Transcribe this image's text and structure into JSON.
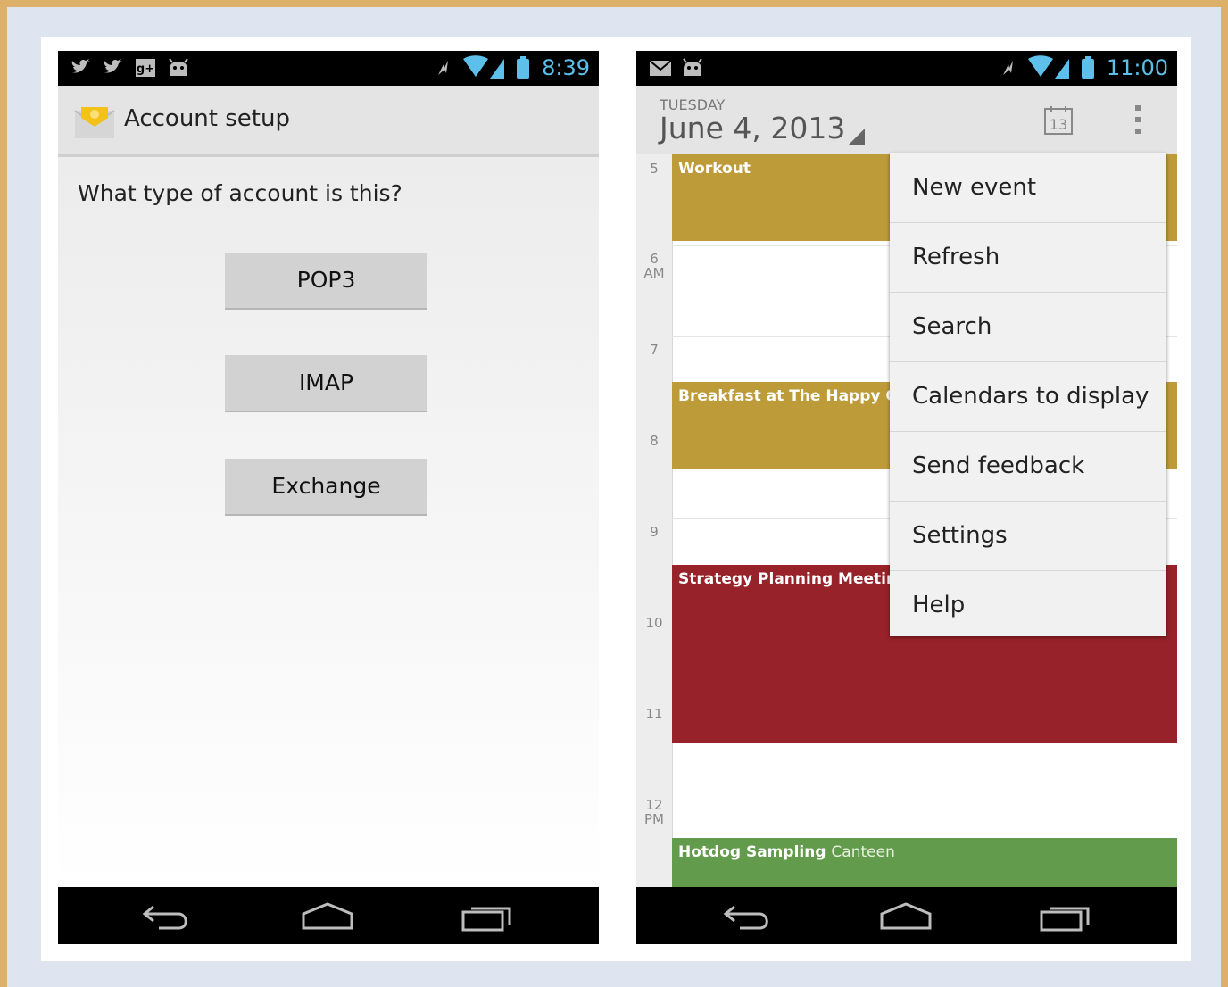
{
  "colors": {
    "outer_border": "#dcb068",
    "frame": "#dee5f1",
    "status_text": "#5cc0ea",
    "event_gold": "#bd9b39",
    "event_red": "#972229",
    "event_green": "#629b4c"
  },
  "phone1": {
    "status": {
      "time": "8:39",
      "icons": [
        "twitter-icon",
        "twitter-icon",
        "google-plus-icon",
        "android-icon",
        "signal-icons",
        "battery-icon"
      ]
    },
    "action_bar": {
      "title": "Account setup",
      "icon": "email-icon"
    },
    "question": "What type of account is this?",
    "buttons": [
      {
        "label": "POP3"
      },
      {
        "label": "IMAP"
      },
      {
        "label": "Exchange"
      }
    ],
    "nav": [
      "back-icon",
      "home-icon",
      "recents-icon"
    ]
  },
  "phone2": {
    "status": {
      "time": "11:00",
      "icons": [
        "gmail-icon",
        "android-icon",
        "signal-icons",
        "battery-icon"
      ]
    },
    "action_bar": {
      "day": "TUESDAY",
      "date": "June 4, 2013",
      "today_number": "13",
      "today_icon": "calendar-today-icon",
      "overflow_icon": "overflow-menu-icon"
    },
    "hours": [
      {
        "n": "5",
        "s": ""
      },
      {
        "n": "6",
        "s": "AM"
      },
      {
        "n": "7",
        "s": ""
      },
      {
        "n": "8",
        "s": ""
      },
      {
        "n": "9",
        "s": ""
      },
      {
        "n": "10",
        "s": ""
      },
      {
        "n": "11",
        "s": ""
      },
      {
        "n": "12",
        "s": "PM"
      }
    ],
    "events": [
      {
        "title": "Workout",
        "location": "",
        "color": "gold"
      },
      {
        "title": "Breakfast at The Happy Gar",
        "location": "",
        "color": "gold"
      },
      {
        "title": "Strategy Planning Meeting",
        "location": "",
        "color": "red"
      },
      {
        "title": "Hotdog Sampling",
        "location": "Canteen",
        "color": "green"
      }
    ],
    "menu": [
      "New event",
      "Refresh",
      "Search",
      "Calendars to display",
      "Send feedback",
      "Settings",
      "Help"
    ],
    "nav": [
      "back-icon",
      "home-icon",
      "recents-icon"
    ]
  }
}
